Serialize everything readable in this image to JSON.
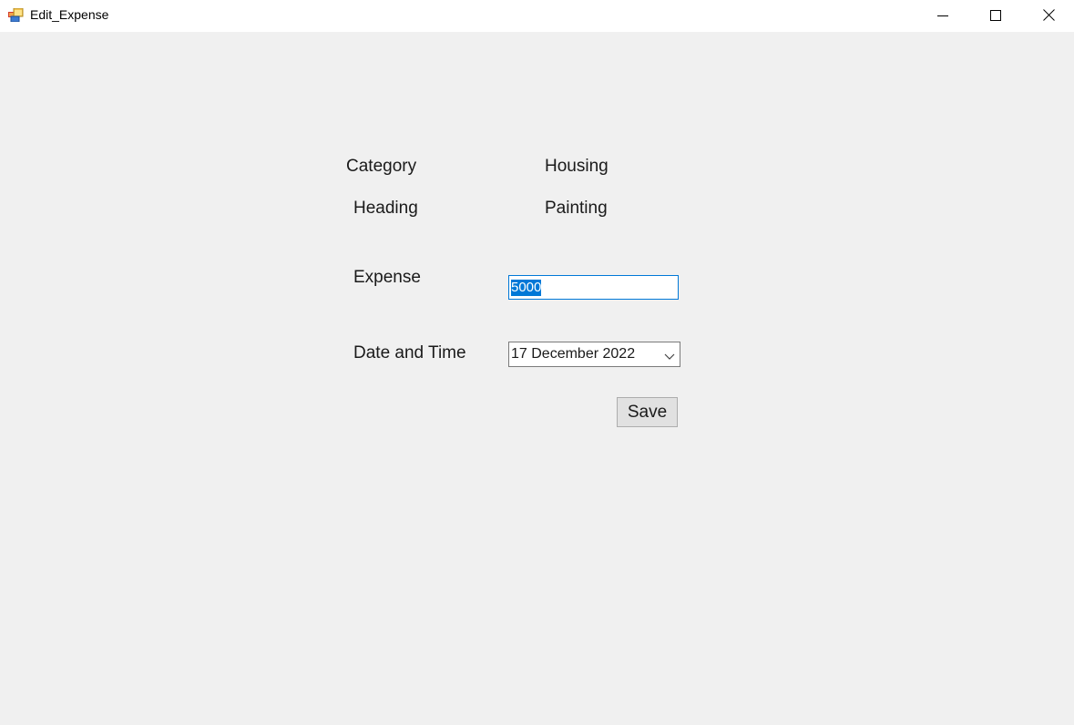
{
  "window": {
    "title": "Edit_Expense",
    "app_icon": "winforms-app-icon",
    "controls": {
      "minimize_icon": "minimize-icon",
      "maximize_icon": "maximize-icon",
      "close_icon": "close-icon"
    }
  },
  "form": {
    "category_label": "Category",
    "category_value": "Housing",
    "heading_label": "Heading",
    "heading_value": "Painting",
    "expense_label": "Expense",
    "expense_value": "5000",
    "date_label": "Date and Time",
    "date_value": "17 December 2022",
    "date_dropdown_icon": "chevron-down-icon",
    "save_label": "Save"
  },
  "colors": {
    "background": "#f0f0f0",
    "titlebar": "#ffffff",
    "focus_accent": "#0078d7",
    "button_face": "#e1e1e1"
  }
}
